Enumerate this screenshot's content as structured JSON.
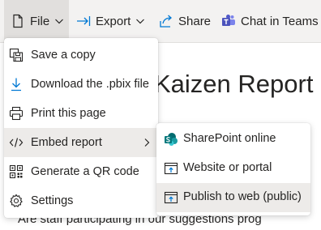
{
  "toolbar": {
    "file_label": "File",
    "export_label": "Export",
    "share_label": "Share",
    "chat_label": "Chat in Teams"
  },
  "report": {
    "title": "Kaizen Report",
    "subtitle_partial": "Are staff participating in our suggestions prog"
  },
  "file_menu": {
    "items": [
      {
        "label": "Save a copy",
        "icon": "save-copy-icon"
      },
      {
        "label": "Download the .pbix file",
        "icon": "download-icon"
      },
      {
        "label": "Print this page",
        "icon": "print-icon"
      },
      {
        "label": "Embed report",
        "icon": "code-icon",
        "has_submenu": true,
        "active": true
      },
      {
        "label": "Generate a QR code",
        "icon": "qr-code-icon"
      },
      {
        "label": "Settings",
        "icon": "gear-icon"
      }
    ]
  },
  "embed_submenu": {
    "items": [
      {
        "label": "SharePoint online",
        "icon": "sharepoint-icon"
      },
      {
        "label": "Website or portal",
        "icon": "website-icon"
      },
      {
        "label": "Publish to web (public)",
        "icon": "publish-web-icon",
        "active": true
      }
    ]
  },
  "colors": {
    "accent": "#0078d4",
    "sharepoint": "#038387",
    "teams": "#5059c9",
    "toolbar_bg": "#f3f2f1",
    "active_bg": "#edebe9"
  }
}
